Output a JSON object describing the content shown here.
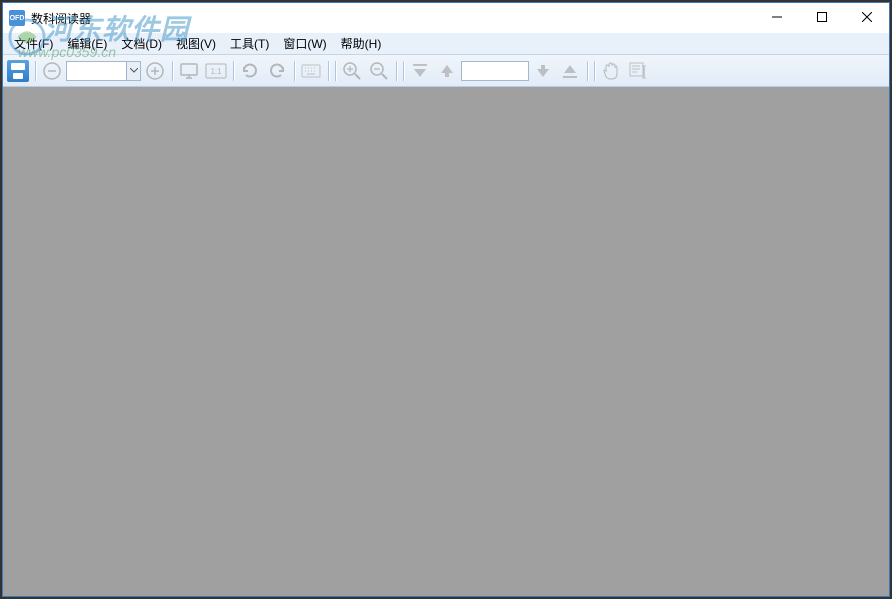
{
  "title": "数科阅读器",
  "app_icon_text": "OFD",
  "menu": {
    "file": "文件(F)",
    "edit": "编辑(E)",
    "doc": "文档(D)",
    "view": "视图(V)",
    "tools": "工具(T)",
    "window": "窗口(W)",
    "help": "帮助(H)"
  },
  "toolbar": {
    "zoom_value": "",
    "page_value": "",
    "ratio_label": "1:1"
  },
  "watermark": {
    "main": "河东软件园",
    "sub": "www.pc0359.cn"
  },
  "colors": {
    "titlebar_bg": "#ffffff",
    "menubar_bg": "#e8f0fa",
    "toolbar_bg": "#e8f0fa",
    "canvas_bg": "#a0a0a0",
    "border": "#3a7ab8"
  }
}
